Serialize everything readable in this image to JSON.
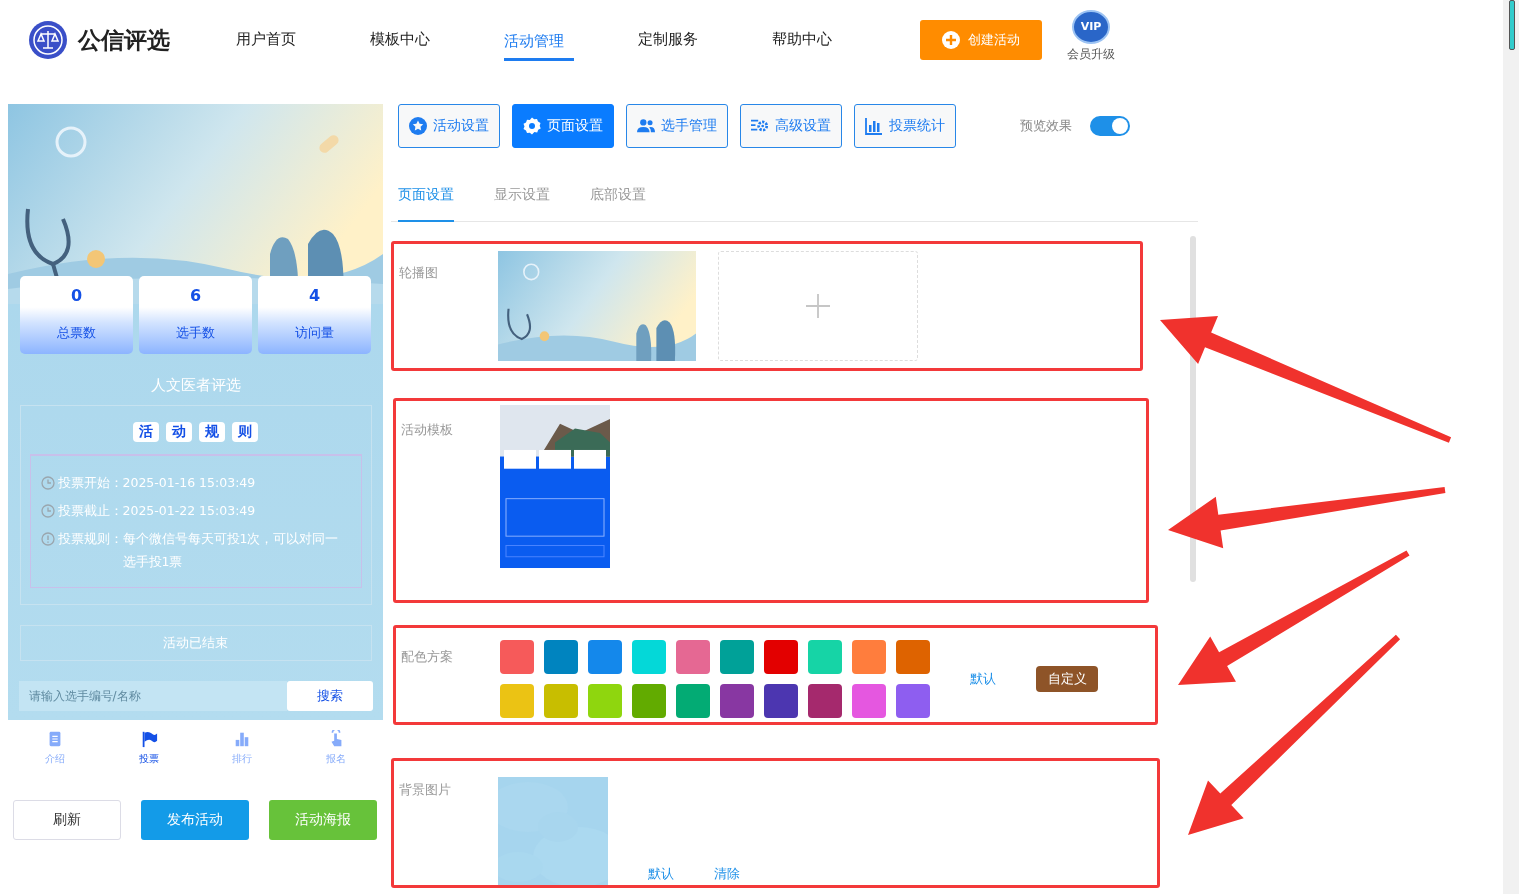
{
  "brand": {
    "name": "公信评选"
  },
  "nav": [
    {
      "label": "用户首页",
      "selected": false
    },
    {
      "label": "模板中心",
      "selected": false
    },
    {
      "label": "活动管理",
      "selected": true
    },
    {
      "label": "定制服务",
      "selected": false
    },
    {
      "label": "帮助中心",
      "selected": false
    }
  ],
  "create_button": "创建活动",
  "vip": {
    "badge": "VIP",
    "label": "会员升级"
  },
  "preview": {
    "stats": [
      {
        "value": "0",
        "label": "总票数"
      },
      {
        "value": "6",
        "label": "选手数"
      },
      {
        "value": "4",
        "label": "访问量"
      }
    ],
    "title": "人文医者评选",
    "rules_heading": [
      "活",
      "动",
      "规",
      "则"
    ],
    "rules": [
      {
        "kind": "clock",
        "label": "投票开始：",
        "value": "2025-01-16 15:03:49"
      },
      {
        "kind": "clock",
        "label": "投票截止：",
        "value": "2025-01-22 15:03:49"
      },
      {
        "kind": "info",
        "label": "投票规则：",
        "value": "每个微信号每天可投1次，可以对同一选手投1票"
      }
    ],
    "status": "活动已结束",
    "search": {
      "placeholder": "请输入选手编号/名称",
      "button": "搜索"
    },
    "tabbar": [
      {
        "label": "介绍",
        "kind": "document",
        "selected": false
      },
      {
        "label": "投票",
        "kind": "flag",
        "selected": true
      },
      {
        "label": "排行",
        "kind": "chart",
        "selected": false
      },
      {
        "label": "报名",
        "kind": "hand",
        "selected": false
      }
    ]
  },
  "actions": [
    {
      "label": "刷新",
      "kind": "plain"
    },
    {
      "label": "发布活动",
      "kind": "primary"
    },
    {
      "label": "活动海报",
      "kind": "success"
    }
  ],
  "toolbar": [
    {
      "label": "活动设置",
      "kind": "star",
      "selected": false
    },
    {
      "label": "页面设置",
      "kind": "gear",
      "selected": true
    },
    {
      "label": "选手管理",
      "kind": "users",
      "selected": false
    },
    {
      "label": "高级设置",
      "kind": "sliders",
      "selected": false
    },
    {
      "label": "投票统计",
      "kind": "chart",
      "selected": false
    }
  ],
  "preview_toggle": {
    "label": "预览效果",
    "on": true
  },
  "subtabs": [
    {
      "label": "页面设置",
      "selected": true
    },
    {
      "label": "显示设置",
      "selected": false
    },
    {
      "label": "底部设置",
      "selected": false
    }
  ],
  "sections": [
    {
      "kind": "carousel",
      "label": "轮播图"
    },
    {
      "kind": "template",
      "label": "活动模板"
    },
    {
      "kind": "palette",
      "label": "配色方案",
      "colors": [
        {
          "color": "#f65a5a"
        },
        {
          "color": "#0084bf"
        },
        {
          "color": "#1488eb"
        },
        {
          "color": "#04d8d8"
        },
        {
          "color": "#e56893"
        },
        {
          "color": "#00a198"
        },
        {
          "color": "#e30000"
        },
        {
          "color": "#16d4a6"
        },
        {
          "color": "#ff7d3d"
        },
        {
          "color": "#de6300"
        },
        {
          "color": "#ebc314"
        },
        {
          "color": "#c8be00"
        },
        {
          "color": "#8fd60e"
        },
        {
          "color": "#62ab00"
        },
        {
          "color": "#03ab74"
        },
        {
          "color": "#8837a2"
        },
        {
          "color": "#4c36b0"
        },
        {
          "color": "#a5296d"
        },
        {
          "color": "#e557e0"
        },
        {
          "color": "#8e5ef0"
        }
      ],
      "default_link": "默认",
      "custom_button": "自定义"
    },
    {
      "kind": "background",
      "label": "背景图片",
      "default_link": "默认",
      "clear_link": "清除"
    }
  ]
}
